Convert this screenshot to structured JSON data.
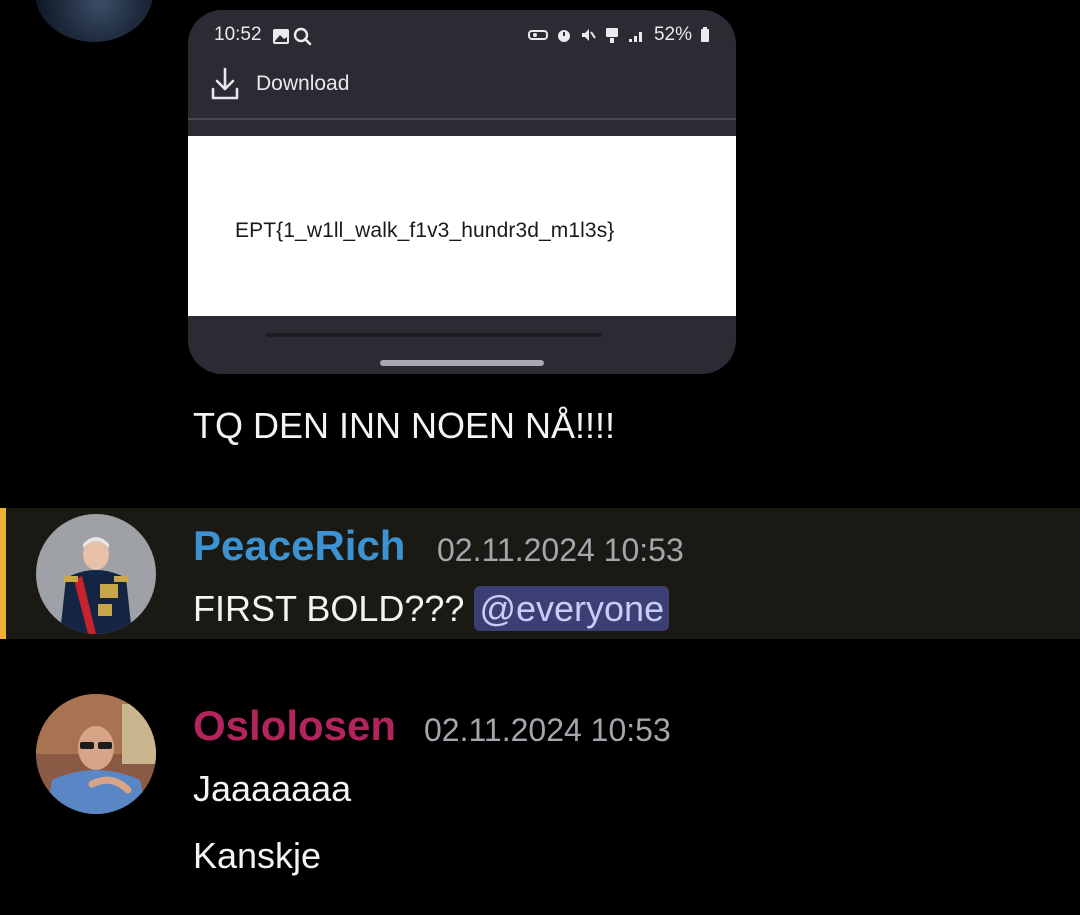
{
  "screenshot": {
    "status_time": "10:52",
    "battery": "52%",
    "download_label": "Download",
    "document_text": "EPT{1_w1ll_walk_f1v3_hundr3d_m1l3s}"
  },
  "messages": {
    "first_text": "TQ DEN INN NOEN NÅ!!!!",
    "second": {
      "author": "PeaceRich",
      "timestamp": "02.11.2024 10:53",
      "text": "FIRST BOLD??? ",
      "mention": "@everyone"
    },
    "third": {
      "author": "Oslolosen",
      "timestamp": "02.11.2024 10:53",
      "lines": [
        "Jaaaaaaa",
        "Kanskje"
      ]
    }
  },
  "colors": {
    "background": "#000000",
    "peacerich_name": "#3b93d3",
    "oslolosen_name": "#b1245c",
    "mention_highlight": "#1b1913",
    "mention_bar": "#f0b232"
  },
  "icons": {
    "download": "download-icon",
    "image": "image-icon",
    "search": "search-icon"
  }
}
